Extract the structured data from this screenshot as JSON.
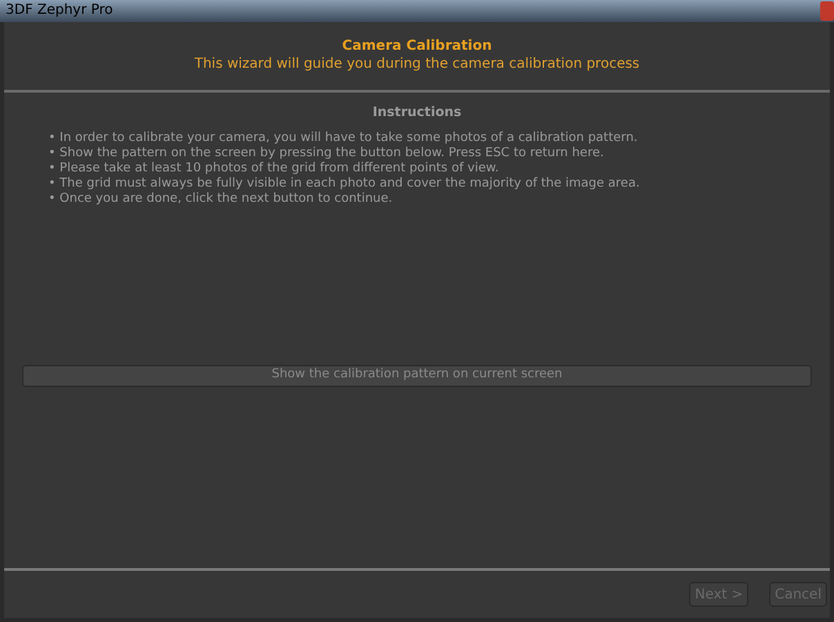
{
  "window": {
    "title": "3DF Zephyr Pro"
  },
  "header": {
    "title": "Camera Calibration",
    "subtitle": "This wizard will guide you during the camera calibration process"
  },
  "instructions": {
    "heading": "Instructions",
    "items": [
      "• In order to calibrate your camera, you will have to take some photos of a calibration pattern.",
      "• Show the pattern on the screen by pressing the button below. Press ESC to return here.",
      "• Please take at least 10 photos of the grid from different points of view.",
      "• The grid must always be fully visible in each photo and cover the majority of the image area.",
      "• Once you are done, click the next button to continue."
    ]
  },
  "pattern_button": {
    "label": "Show the calibration pattern on current screen"
  },
  "buttons": [
    {
      "label": "Next >",
      "disabled": true
    },
    {
      "label": "Cancel",
      "disabled": true
    }
  ]
}
